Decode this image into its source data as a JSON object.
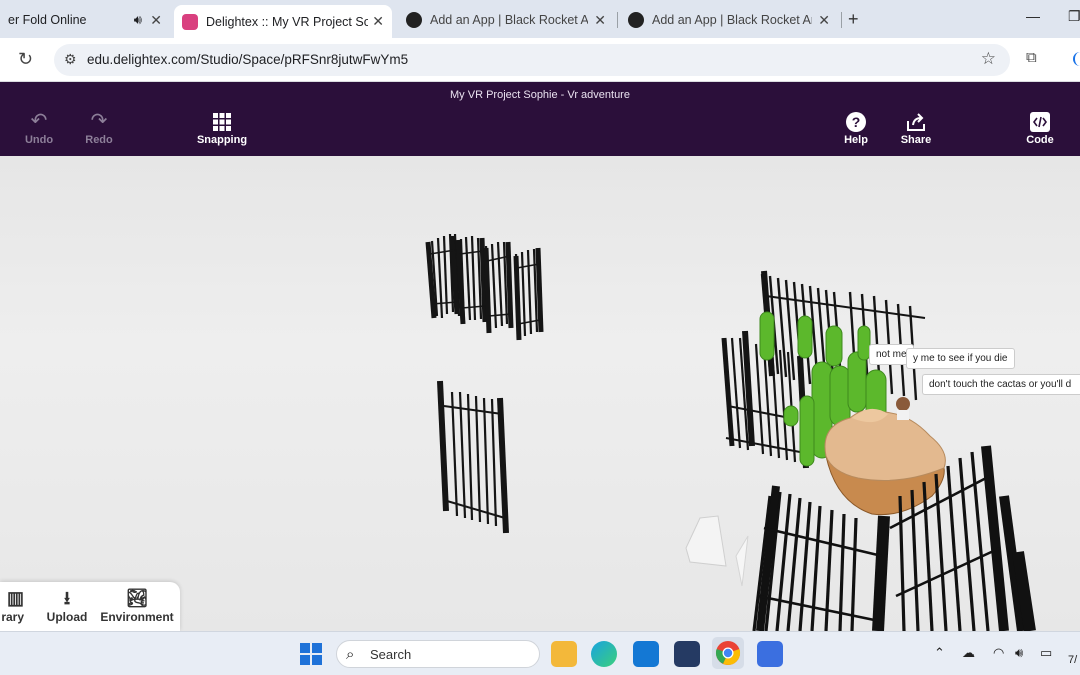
{
  "browser": {
    "tabs": [
      {
        "title": "er Fold Online",
        "audio": true
      },
      {
        "title": "Delightex :: My VR Project Sophi",
        "active": true
      },
      {
        "title": "Add an App | Black Rocket Arca"
      },
      {
        "title": "Add an App | Black Rocket Arca"
      }
    ],
    "url": "edu.delightex.com/Studio/Space/pRFSnr8jutwFwYm5"
  },
  "app": {
    "project_title": "My VR Project Sophie - Vr adventure",
    "toolbar": {
      "undo": "Undo",
      "redo": "Redo",
      "snapping": "Snapping",
      "help": "Help",
      "share": "Share",
      "code": "Code"
    },
    "speech_bubbles": {
      "b1": "not me",
      "b2": "y me to see if you die",
      "b3": "don't touch the cactas or you'll d"
    },
    "library_panel": {
      "library": "rary",
      "upload": "Upload",
      "environment": "Environment"
    }
  },
  "taskbar": {
    "search_placeholder": "Search",
    "clock_partial": "7/"
  },
  "colors": {
    "app_toolbar": "#2b0f3a",
    "tab_strip": "#dfe5ef",
    "canvas": "#e8e8e8"
  }
}
